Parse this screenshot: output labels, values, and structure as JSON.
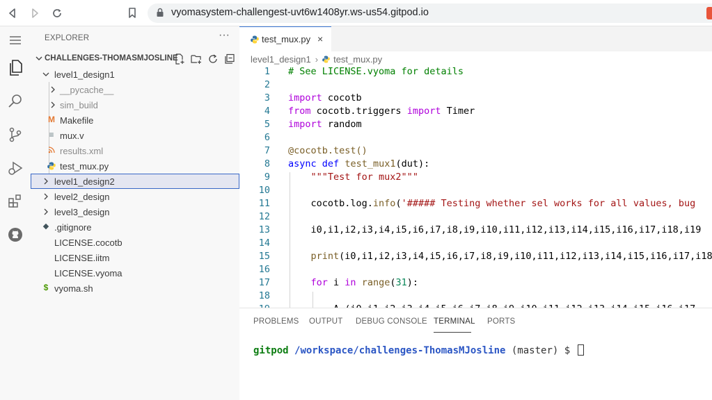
{
  "browser": {
    "url": "vyomasystem-challengest-uvt6w1408yr.ws-us54.gitpod.io"
  },
  "sidebar": {
    "title": "EXPLORER",
    "more": "···",
    "workspace": "CHALLENGES-THOMASMJOSLINE",
    "items": [
      {
        "label": "level1_design1",
        "kind": "folder-open"
      },
      {
        "label": "__pycache__",
        "kind": "folder"
      },
      {
        "label": "sim_build",
        "kind": "folder"
      },
      {
        "label": "Makefile",
        "kind": "makefile",
        "icon": "M"
      },
      {
        "label": "mux.v",
        "kind": "file",
        "icon": "≡"
      },
      {
        "label": "results.xml",
        "kind": "rss",
        "icon": "⋯"
      },
      {
        "label": "test_mux.py",
        "kind": "python"
      },
      {
        "label": "level1_design2",
        "kind": "folder"
      },
      {
        "label": "level2_design",
        "kind": "folder"
      },
      {
        "label": "level3_design",
        "kind": "folder"
      },
      {
        "label": ".gitignore",
        "kind": "git",
        "icon": "◆"
      },
      {
        "label": "LICENSE.cocotb",
        "kind": "plain"
      },
      {
        "label": "LICENSE.iitm",
        "kind": "plain"
      },
      {
        "label": "LICENSE.vyoma",
        "kind": "plain"
      },
      {
        "label": "vyoma.sh",
        "kind": "shell",
        "icon": "$"
      }
    ]
  },
  "editor": {
    "tab": {
      "label": "test_mux.py",
      "close": "×"
    },
    "breadcrumb": [
      "level1_design1",
      "test_mux.py"
    ],
    "lines": [
      {
        "n": "1",
        "tokens": [
          [
            "c-comment",
            "# See LICENSE.vyoma for details"
          ]
        ]
      },
      {
        "n": "2",
        "tokens": []
      },
      {
        "n": "3",
        "tokens": [
          [
            "c-kw",
            "import"
          ],
          [
            "",
            " cocotb"
          ]
        ]
      },
      {
        "n": "4",
        "tokens": [
          [
            "c-kw",
            "from"
          ],
          [
            "",
            " cocotb.triggers "
          ],
          [
            "c-kw",
            "import"
          ],
          [
            "",
            " Timer"
          ]
        ]
      },
      {
        "n": "5",
        "tokens": [
          [
            "c-kw",
            "import"
          ],
          [
            "",
            " random"
          ]
        ]
      },
      {
        "n": "6",
        "tokens": []
      },
      {
        "n": "7",
        "tokens": [
          [
            "c-dec",
            "@cocotb.test()"
          ]
        ]
      },
      {
        "n": "8",
        "tokens": [
          [
            "c-kw2",
            "async"
          ],
          [
            "",
            " "
          ],
          [
            "c-kw2",
            "def"
          ],
          [
            "",
            " "
          ],
          [
            "c-fn",
            "test_mux1"
          ],
          [
            "",
            "(dut):"
          ]
        ]
      },
      {
        "n": "9",
        "tokens": [
          [
            "",
            "    "
          ],
          [
            "c-str",
            "\"\"\"Test for mux2\"\"\""
          ]
        ]
      },
      {
        "n": "10",
        "tokens": []
      },
      {
        "n": "11",
        "tokens": [
          [
            "",
            "    cocotb.log."
          ],
          [
            "c-fn",
            "info"
          ],
          [
            "",
            "("
          ],
          [
            "c-str",
            "'##### Testing whether sel works for all values, bug"
          ]
        ]
      },
      {
        "n": "12",
        "tokens": []
      },
      {
        "n": "13",
        "tokens": [
          [
            "",
            "    i0,i1,i2,i3,i4,i5,i6,i7,i8,i9,i10,i11,i12,i13,i14,i15,i16,i17,i18,i19"
          ]
        ]
      },
      {
        "n": "14",
        "tokens": []
      },
      {
        "n": "15",
        "tokens": [
          [
            "",
            "    "
          ],
          [
            "c-fn",
            "print"
          ],
          [
            "",
            "(i0,i1,i2,i3,i4,i5,i6,i7,i8,i9,i10,i11,i12,i13,i14,i15,i16,i17,i18"
          ]
        ]
      },
      {
        "n": "16",
        "tokens": []
      },
      {
        "n": "17",
        "tokens": [
          [
            "",
            "    "
          ],
          [
            "c-kw",
            "for"
          ],
          [
            "",
            " i "
          ],
          [
            "c-kw",
            "in"
          ],
          [
            "",
            " "
          ],
          [
            "c-fn",
            "range"
          ],
          [
            "",
            "("
          ],
          [
            "c-num",
            "31"
          ],
          [
            "",
            "):"
          ]
        ]
      },
      {
        "n": "18",
        "tokens": []
      },
      {
        "n": "19",
        "tokens": [
          [
            "",
            "        A (i0,i1,i2,i3,i4,i5,i6,i7,i8,i9,i10,i11,i12,i13,i14,i15,i16,i17"
          ]
        ]
      }
    ]
  },
  "panel": {
    "tabs": [
      "PROBLEMS",
      "OUTPUT",
      "DEBUG CONSOLE",
      "TERMINAL",
      "PORTS"
    ],
    "active": "TERMINAL",
    "terminal": {
      "user": "gitpod",
      "path": "/workspace/challenges-ThomasMJosline",
      "branch": " (master) $ "
    }
  }
}
